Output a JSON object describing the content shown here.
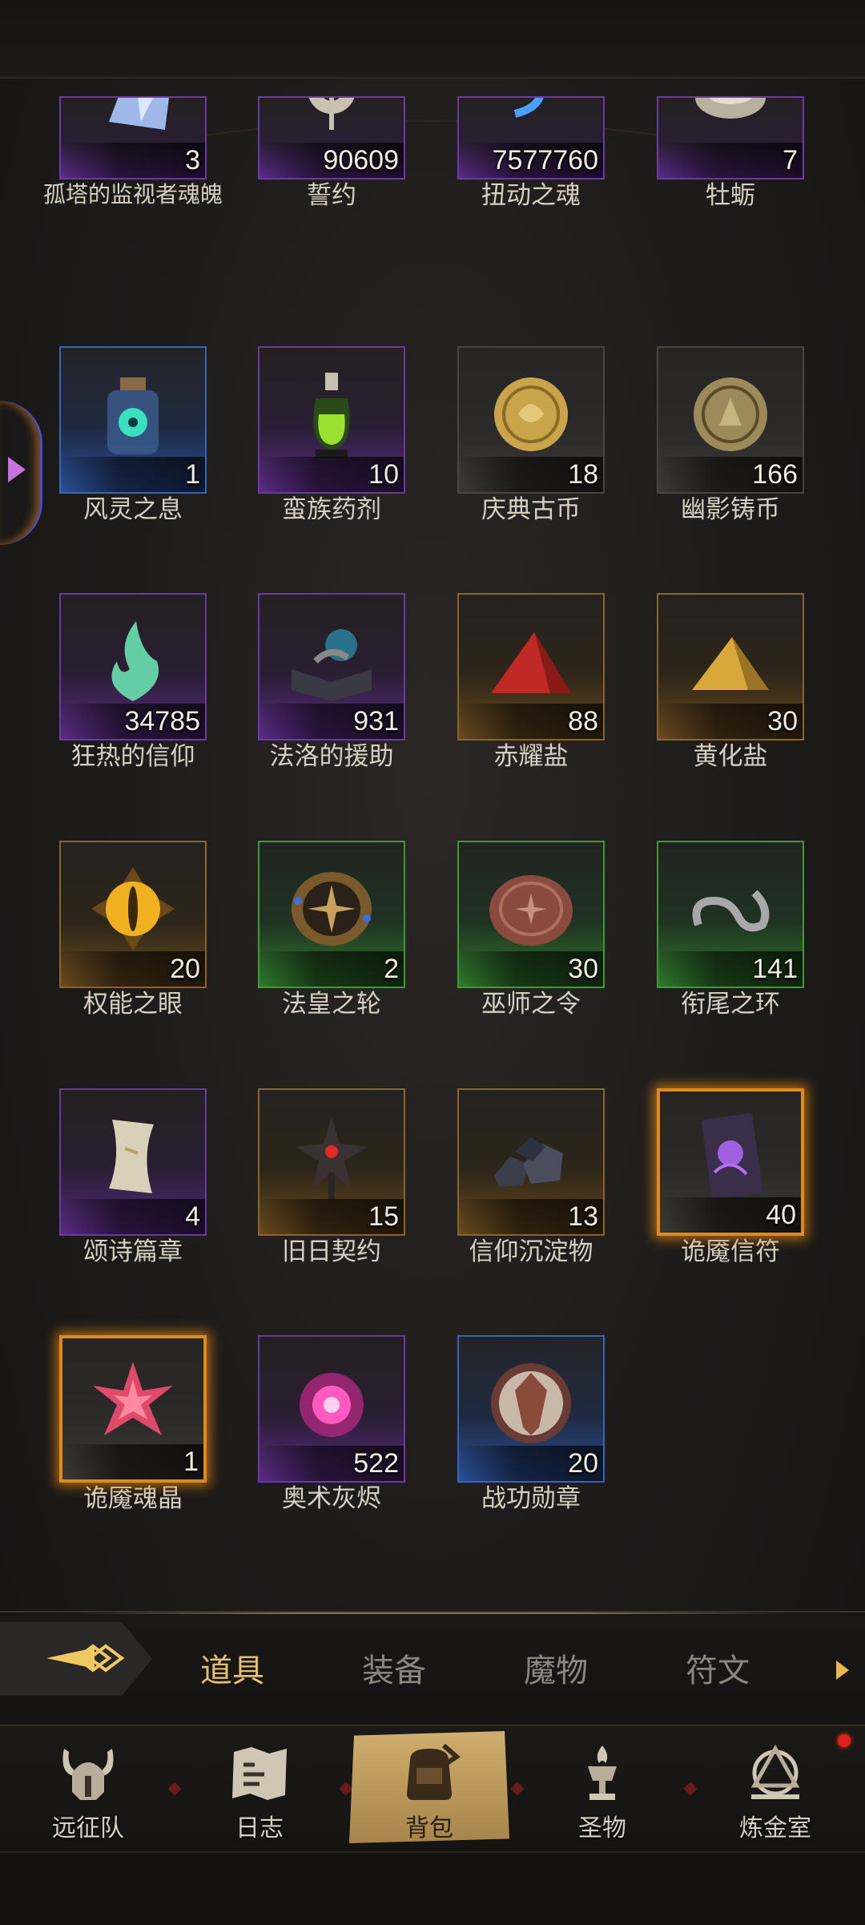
{
  "items": [
    {
      "name": "孤塔的监视者魂魄",
      "count": "3",
      "rarity": "purple",
      "icon": "crystal-shard-icon",
      "highlight": false
    },
    {
      "name": "誓约",
      "count": "90609",
      "rarity": "purple",
      "icon": "oath-emblem-icon",
      "highlight": false
    },
    {
      "name": "扭动之魂",
      "count": "7577760",
      "rarity": "purple",
      "icon": "twisting-soul-icon",
      "highlight": false
    },
    {
      "name": "牡蛎",
      "count": "7",
      "rarity": "purple",
      "icon": "oyster-icon",
      "highlight": false
    },
    {
      "name": "风灵之息",
      "count": "1",
      "rarity": "blue",
      "icon": "spirit-bottle-icon",
      "highlight": false
    },
    {
      "name": "蛮族药剂",
      "count": "10",
      "rarity": "purple",
      "icon": "potion-flask-icon",
      "highlight": false
    },
    {
      "name": "庆典古币",
      "count": "18",
      "rarity": "gray",
      "icon": "gold-coin-icon",
      "highlight": false
    },
    {
      "name": "幽影铸币",
      "count": "166",
      "rarity": "gray",
      "icon": "bronze-coin-icon",
      "highlight": false
    },
    {
      "name": "狂热的信仰",
      "count": "34785",
      "rarity": "purple",
      "icon": "green-flame-icon",
      "highlight": false
    },
    {
      "name": "法洛的援助",
      "count": "931",
      "rarity": "purple",
      "icon": "spellbook-icon",
      "highlight": false
    },
    {
      "name": "赤耀盐",
      "count": "88",
      "rarity": "gold",
      "icon": "red-salt-pile-icon",
      "highlight": false
    },
    {
      "name": "黄化盐",
      "count": "30",
      "rarity": "gold",
      "icon": "yellow-salt-pile-icon",
      "highlight": false
    },
    {
      "name": "权能之眼",
      "count": "20",
      "rarity": "gold",
      "icon": "golden-eye-icon",
      "highlight": false
    },
    {
      "name": "法皇之轮",
      "count": "2",
      "rarity": "green",
      "icon": "compass-wheel-icon",
      "highlight": false
    },
    {
      "name": "巫师之令",
      "count": "30",
      "rarity": "green",
      "icon": "copper-token-icon",
      "highlight": false
    },
    {
      "name": "衔尾之环",
      "count": "141",
      "rarity": "green",
      "icon": "ouroboros-ring-icon",
      "highlight": false
    },
    {
      "name": "颂诗篇章",
      "count": "4",
      "rarity": "purple",
      "icon": "scroll-page-icon",
      "highlight": false
    },
    {
      "name": "旧日契约",
      "count": "15",
      "rarity": "gold",
      "icon": "dark-star-staff-icon",
      "highlight": false
    },
    {
      "name": "信仰沉淀物",
      "count": "13",
      "rarity": "gold",
      "icon": "dark-ore-icon",
      "highlight": false
    },
    {
      "name": "诡魇信符",
      "count": "40",
      "rarity": "gray",
      "icon": "cursed-card-icon",
      "highlight": true
    },
    {
      "name": "诡魇魂晶",
      "count": "1",
      "rarity": "gray",
      "icon": "pink-star-crystal-icon",
      "highlight": true
    },
    {
      "name": "奥术灰烬",
      "count": "522",
      "rarity": "purple",
      "icon": "arcane-orb-icon",
      "highlight": false
    },
    {
      "name": "战功勋章",
      "count": "20",
      "rarity": "blue",
      "icon": "medal-shield-icon",
      "highlight": false
    }
  ],
  "tabs": {
    "items": "道具",
    "equipment": "装备",
    "monsters": "魔物",
    "runes": "符文"
  },
  "nav": {
    "expedition": "远征队",
    "journal": "日志",
    "backpack": "背包",
    "relics": "圣物",
    "alchemy": "炼金室"
  },
  "colors": {
    "active_tab": "#e6c06b",
    "inactive_tab": "#8b8680",
    "highlight_glow": "#e08a1a",
    "notification": "#e0201a"
  }
}
